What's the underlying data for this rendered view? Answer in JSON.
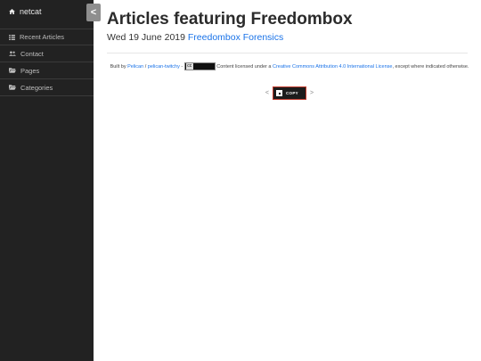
{
  "sidebar": {
    "brand": "netcat",
    "items": [
      {
        "label": "Recent Articles",
        "icon": "list-icon"
      },
      {
        "label": "Contact",
        "icon": "users-icon"
      },
      {
        "label": "Pages",
        "icon": "folder-open-icon"
      },
      {
        "label": "Categories",
        "icon": "folder-open-icon"
      }
    ]
  },
  "toggle": {
    "label": "<"
  },
  "main": {
    "title": "Articles featuring Freedombox",
    "date": "Wed 19 June 2019",
    "category_link": "Freedombox Forensics"
  },
  "footer": {
    "built_by": "Built by",
    "pelican": "Pelican",
    "slash": " / ",
    "theme": "pelican-twitchy",
    "dash": " - ",
    "license_pre": " Content licensed under a ",
    "license_link": "Creative Commons Attribution 4.0 International License",
    "license_post": ", except where indicated otherwise."
  },
  "pager": {
    "prev": "<",
    "next": ">",
    "badge_text": "COPY"
  }
}
